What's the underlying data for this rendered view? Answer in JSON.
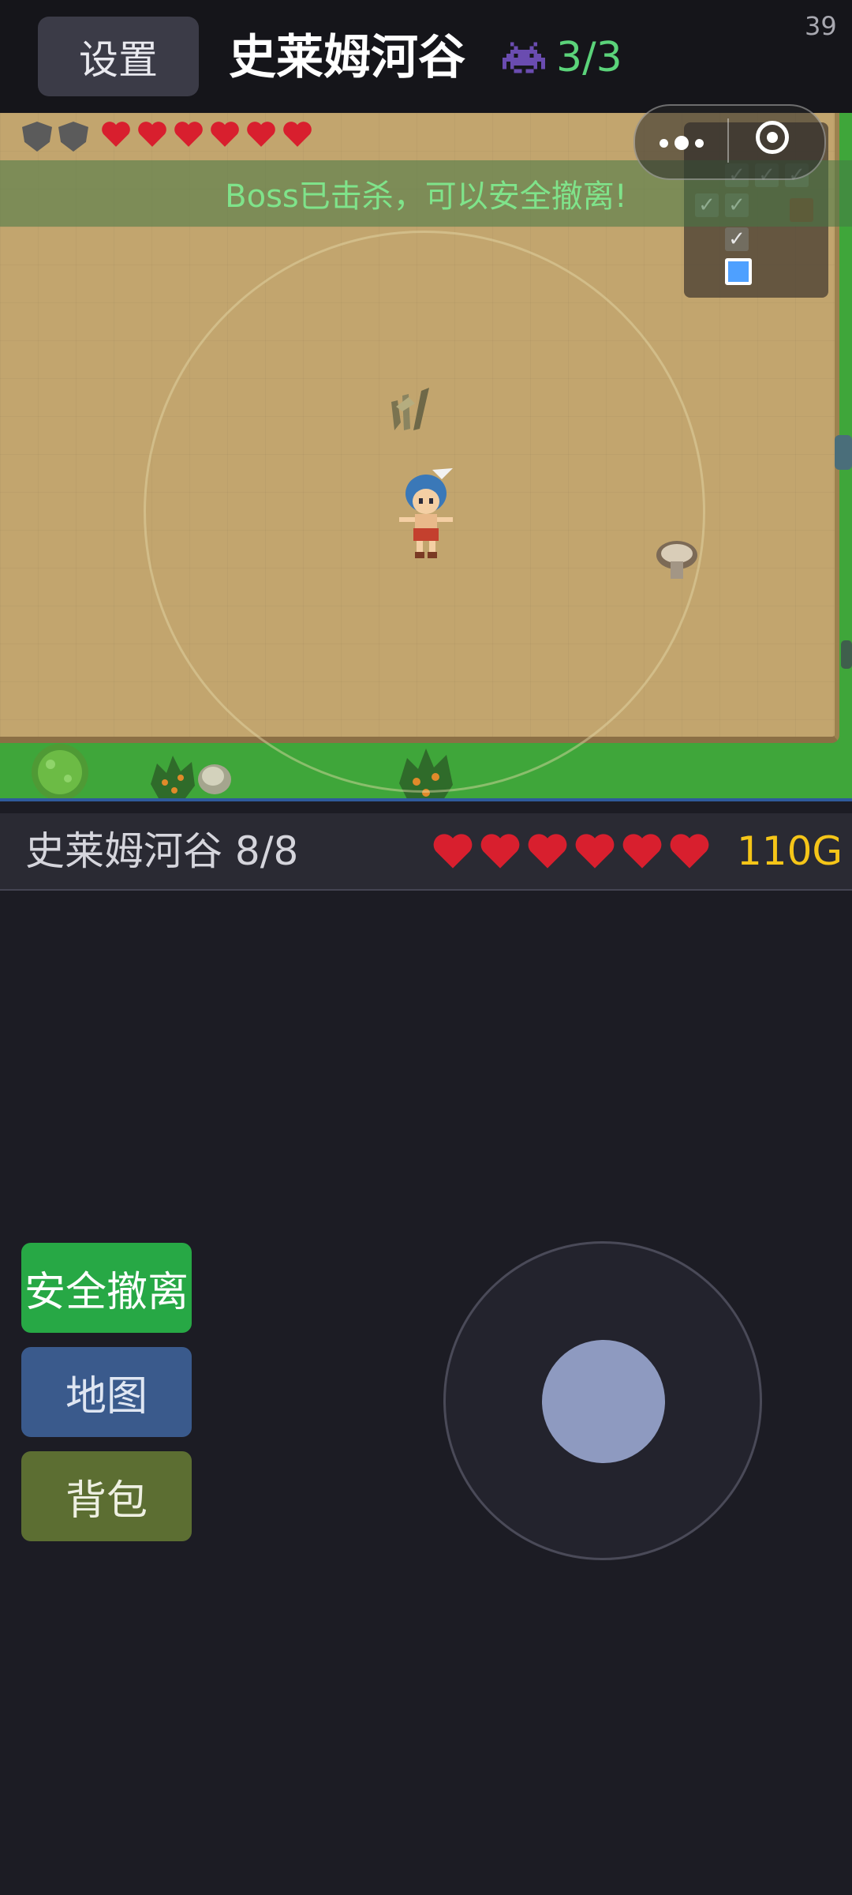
{
  "header": {
    "settings_label": "设置",
    "level_title": "史莱姆河谷",
    "enemy_icon": "space-invader-icon",
    "enemy_count": "3/3",
    "fps": "39"
  },
  "hud": {
    "shields": 2,
    "hearts": 6,
    "boss_banner": "Boss已击杀，可以安全撤离!"
  },
  "minimap": {
    "rooms": [
      "cleared",
      "cleared",
      "cleared",
      "cleared",
      "cleared",
      "boss",
      "cleared",
      "current"
    ]
  },
  "status": {
    "level_progress": "史莱姆河谷 8/8",
    "hearts": 6,
    "gold": "110G"
  },
  "controls": {
    "evacuate_label": "安全撤离",
    "map_label": "地图",
    "bag_label": "背包"
  },
  "colors": {
    "accent_green": "#27a845",
    "gold": "#f5c518",
    "heart": "#d81f2e",
    "enemy_count": "#5bd37a",
    "banner_text": "#7fe38a"
  }
}
